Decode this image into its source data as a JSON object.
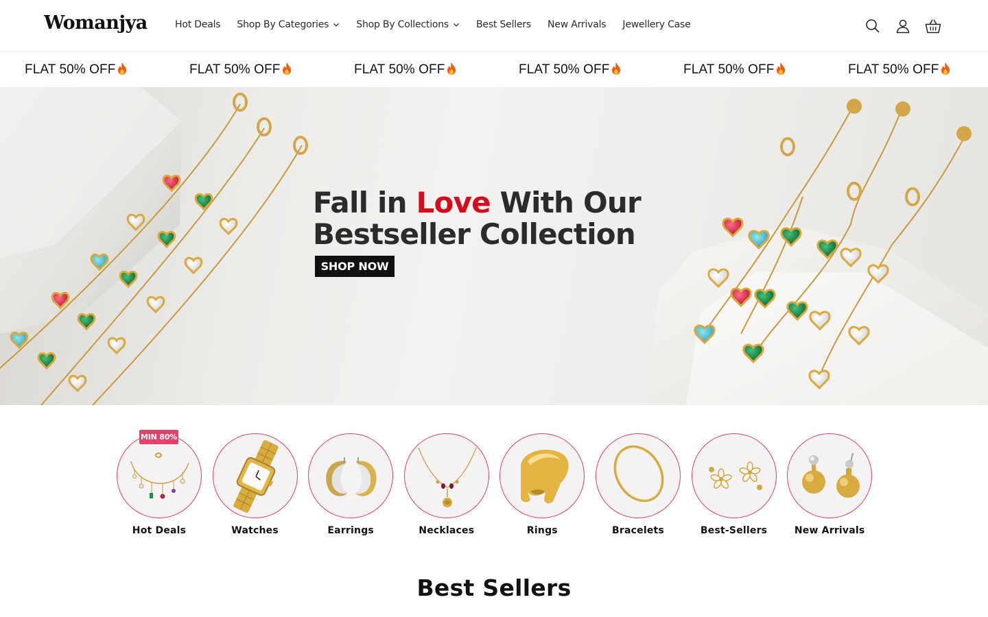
{
  "header": {
    "logo": "Womanjya",
    "nav": [
      {
        "label": "Hot Deals",
        "has_dropdown": false
      },
      {
        "label": "Shop By Categories",
        "has_dropdown": true
      },
      {
        "label": "Shop By Collections",
        "has_dropdown": true
      },
      {
        "label": "Best Sellers",
        "has_dropdown": false
      },
      {
        "label": "New Arrivals",
        "has_dropdown": false
      },
      {
        "label": "Jewellery Case",
        "has_dropdown": false
      }
    ],
    "icons": [
      "search-icon",
      "account-icon",
      "cart-icon"
    ]
  },
  "marquee": {
    "items": [
      "FLAT 50% OFF",
      "FLAT 50% OFF",
      "FLAT 50% OFF",
      "FLAT 50% OFF",
      "FLAT 50% OFF",
      "FLAT 50% OFF"
    ],
    "emoji_icon": "fire-icon"
  },
  "hero": {
    "line1_prefix": "Fall in ",
    "line1_highlight": "Love",
    "line1_suffix": " With Our",
    "line2": "Bestseller Collection",
    "cta": "SHOP NOW",
    "colors": {
      "highlight": "#d40d1e",
      "cta_bg": "#111111"
    }
  },
  "categories": {
    "badge": "MIN 80%",
    "items": [
      {
        "label": "Hot Deals",
        "icon": "anklet-icon"
      },
      {
        "label": "Watches",
        "icon": "watch-icon"
      },
      {
        "label": "Earrings",
        "icon": "hoop-earrings-icon"
      },
      {
        "label": "Necklaces",
        "icon": "necklace-icon"
      },
      {
        "label": "Rings",
        "icon": "ring-icon"
      },
      {
        "label": "Bracelets",
        "icon": "bangle-icon"
      },
      {
        "label": "Best-Sellers",
        "icon": "flower-earrings-icon"
      },
      {
        "label": "New Arrivals",
        "icon": "drop-earrings-icon"
      }
    ],
    "colors": {
      "ring": "#d6426b",
      "badge": "#e0436b"
    }
  },
  "best_sellers": {
    "title": "Best Sellers"
  }
}
